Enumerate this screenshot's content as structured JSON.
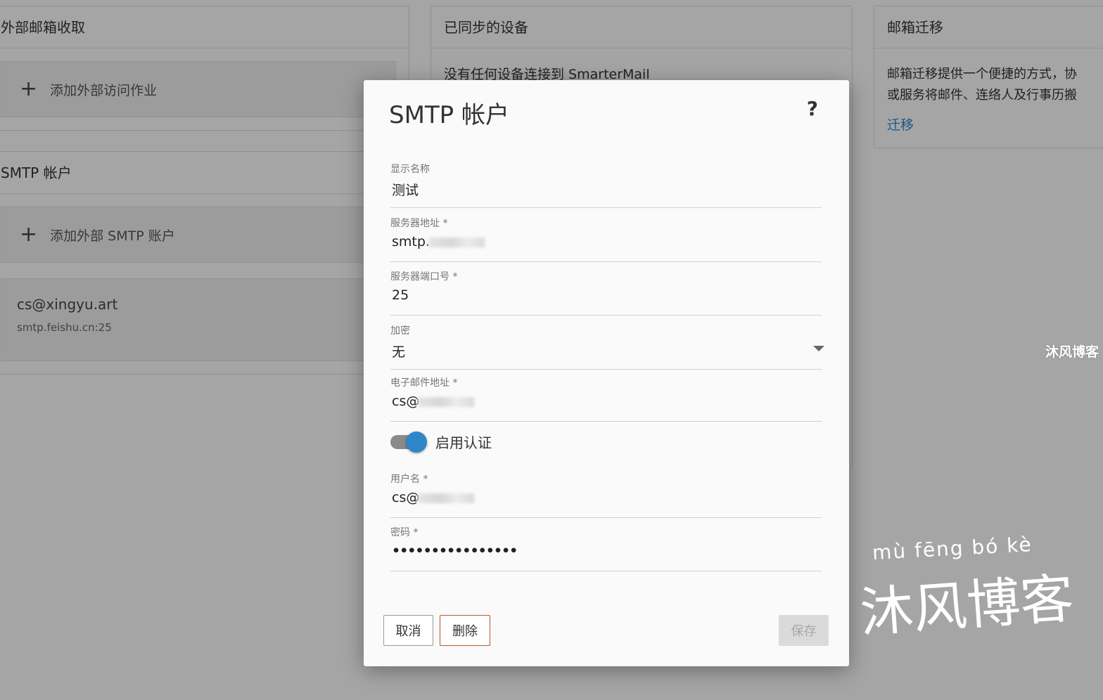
{
  "background": {
    "external_fetch": {
      "title": "外部邮箱收取",
      "add_label": "添加外部访问作业"
    },
    "smtp_section": {
      "title": "SMTP 帐户",
      "add_label": "添加外部 SMTP 账户",
      "account": {
        "email": "cs@xingyu.art",
        "server": "smtp.feishu.cn:25"
      }
    },
    "synced_devices": {
      "title": "已同步的设备",
      "message": "没有任何设备连接到 SmarterMail"
    },
    "migration": {
      "title": "邮箱迁移",
      "line1": "邮箱迁移提供一个便捷的方式，协",
      "line2": "或服务将邮件、连络人及行事历搬",
      "link": "迁移"
    }
  },
  "modal": {
    "title": "SMTP 帐户",
    "help": "?",
    "fields": {
      "display_name": {
        "label": "显示名称",
        "value": "测试"
      },
      "server": {
        "label": "服务器地址 *",
        "value": "smtp."
      },
      "port": {
        "label": "服务器端口号 *",
        "value": "25"
      },
      "encryption": {
        "label": "加密",
        "value": "无"
      },
      "email": {
        "label": "电子邮件地址 *",
        "value": "cs@"
      },
      "username": {
        "label": "用户名 *",
        "value": "cs@"
      },
      "password": {
        "label": "密码 *",
        "value": "••••••••••••••••"
      }
    },
    "auth_toggle": {
      "label": "启用认证",
      "enabled": true
    },
    "buttons": {
      "cancel": "取消",
      "delete": "删除",
      "save": "保存"
    }
  },
  "watermark": {
    "small": "沐风博客",
    "pinyin": "mù  fēng  bó   kè",
    "big": "沐风博客"
  },
  "colors": {
    "accent": "#2f86c8",
    "delete_border": "#b5582a",
    "link": "#2f86c8"
  }
}
